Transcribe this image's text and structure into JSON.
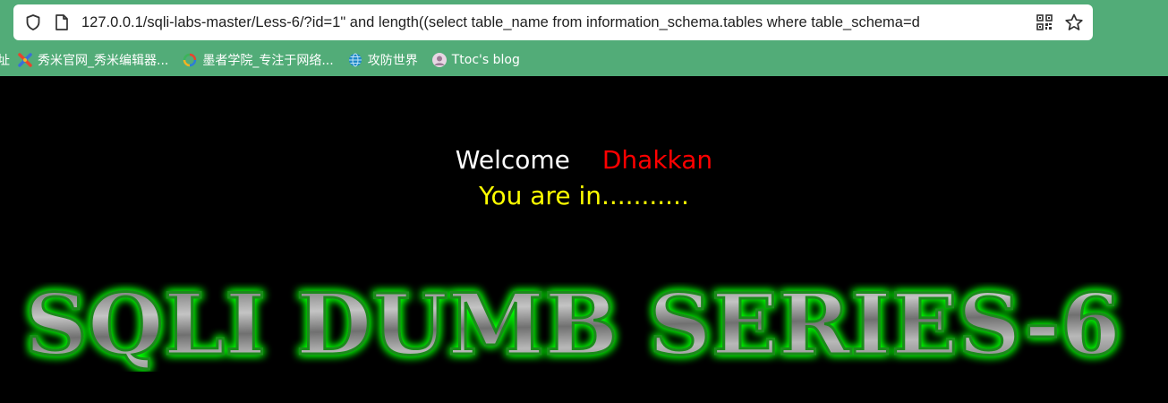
{
  "browser": {
    "url": "127.0.0.1/sqli-labs-master/Less-6/?id=1\" and length((select table_name from information_schema.tables where table_schema=d",
    "bookmarks": [
      {
        "label": "址",
        "icon": "cut-off-icon"
      },
      {
        "label": "秀米官网_秀米编辑器...",
        "icon": "xiumi-icon"
      },
      {
        "label": "墨者学院_专注于网络...",
        "icon": "mozhe-icon"
      },
      {
        "label": "攻防世界",
        "icon": "globe-icon"
      },
      {
        "label": "Ttoc's blog",
        "icon": "avatar-icon"
      }
    ]
  },
  "page": {
    "welcome": "Welcome",
    "name": "Dhakkan",
    "status": "You are in...........",
    "banner": "SQLI DUMB SERIES-6"
  },
  "colors": {
    "chrome_green": "#52ac78",
    "welcome": "#ffffff",
    "name": "#ff0000",
    "status": "#ffff00",
    "banner_glow": "#00ff00"
  }
}
